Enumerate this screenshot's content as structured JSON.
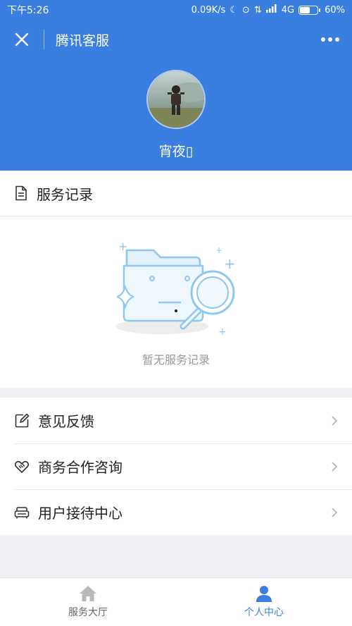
{
  "status_bar": {
    "time": "下午5:26",
    "speed": "0.09K/s",
    "network": "4G",
    "battery": "60%",
    "battery_level": 0.6,
    "icons": [
      "moon-icon",
      "alarm-icon",
      "data-arrows-icon",
      "signal-icon",
      "battery-icon"
    ]
  },
  "nav": {
    "title": "腾讯客服",
    "close_icon": "close-icon",
    "more_icon": "more-dots-icon"
  },
  "profile": {
    "username": "宵夜▯"
  },
  "service_records": {
    "title": "服务记录",
    "empty_text": "暂无服务记录"
  },
  "menu": {
    "items": [
      {
        "label": "意见反馈",
        "icon": "edit-icon"
      },
      {
        "label": "商务合作咨询",
        "icon": "handshake-icon"
      },
      {
        "label": "用户接待中心",
        "icon": "sofa-icon"
      }
    ]
  },
  "tabs": [
    {
      "label": "服务大厅",
      "icon": "home-icon",
      "active": false
    },
    {
      "label": "个人中心",
      "icon": "person-icon",
      "active": true
    }
  ],
  "colors": {
    "header_blue": "#3a7ee0",
    "active_tab": "#3a7ee0",
    "inactive_tab": "#666666",
    "background": "#efeff4"
  }
}
